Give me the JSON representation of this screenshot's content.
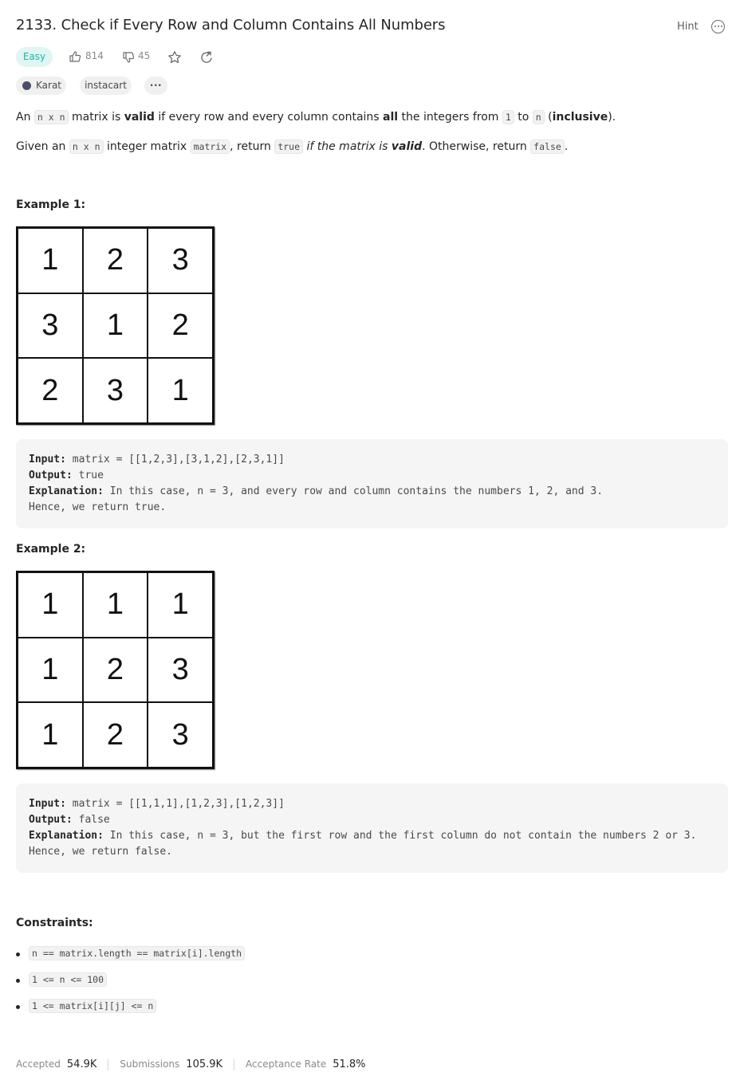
{
  "header": {
    "title": "2133. Check if Every Row and Column Contains All Numbers",
    "hint_label": "Hint",
    "more_icon": "more-circle-icon"
  },
  "meta": {
    "difficulty": "Easy",
    "likes": "814",
    "dislikes": "45",
    "colors": {
      "easy_text": "#1cb8a2",
      "easy_bg": "#e0f6f3"
    }
  },
  "tags": {
    "companies": [
      "Karat",
      "instacart"
    ],
    "more": "···"
  },
  "description": {
    "p1": {
      "t1": "An ",
      "c1": "n x n",
      "t2": " matrix is ",
      "b1": "valid",
      "t3": " if every row and every column contains ",
      "b2": "all",
      "t4": " the integers from ",
      "c2": "1",
      "t5": " to ",
      "c3": "n",
      "t6": " (",
      "b3": "inclusive",
      "t7": ")."
    },
    "p2": {
      "t1": "Given an ",
      "c1": "n x n",
      "t2": " integer matrix ",
      "c2": "matrix",
      "t3": ", return ",
      "c3": "true",
      "t4": " ",
      "i1": "if the matrix is ",
      "bi1": "valid",
      "t5": ". Otherwise, return ",
      "c4": "false",
      "t6": "."
    }
  },
  "examples": [
    {
      "title": "Example 1:",
      "grid": [
        [
          "1",
          "2",
          "3"
        ],
        [
          "3",
          "1",
          "2"
        ],
        [
          "2",
          "3",
          "1"
        ]
      ],
      "input_label": "Input:",
      "input": " matrix = [[1,2,3],[3,1,2],[2,3,1]]",
      "output_label": "Output:",
      "output": " true",
      "explanation_label": "Explanation:",
      "explanation": " In this case, n = 3, and every row and column contains the numbers 1, 2, and 3.",
      "explanation2": "Hence, we return true."
    },
    {
      "title": "Example 2:",
      "grid": [
        [
          "1",
          "1",
          "1"
        ],
        [
          "1",
          "2",
          "3"
        ],
        [
          "1",
          "2",
          "3"
        ]
      ],
      "input_label": "Input:",
      "input": " matrix = [[1,1,1],[1,2,3],[1,2,3]]",
      "output_label": "Output:",
      "output": " false",
      "explanation_label": "Explanation:",
      "explanation": " In this case, n = 3, but the first row and the first column do not contain the numbers 2 or 3.",
      "explanation2": "Hence, we return false."
    }
  ],
  "constraints": {
    "title": "Constraints:",
    "items": [
      "n == matrix.length == matrix[i].length",
      "1 <= n <= 100",
      "1 <= matrix[i][j] <= n"
    ]
  },
  "footer": {
    "accepted_label": "Accepted",
    "accepted": "54.9K",
    "submissions_label": "Submissions",
    "submissions": "105.9K",
    "rate_label": "Acceptance Rate",
    "rate": "51.8%"
  }
}
